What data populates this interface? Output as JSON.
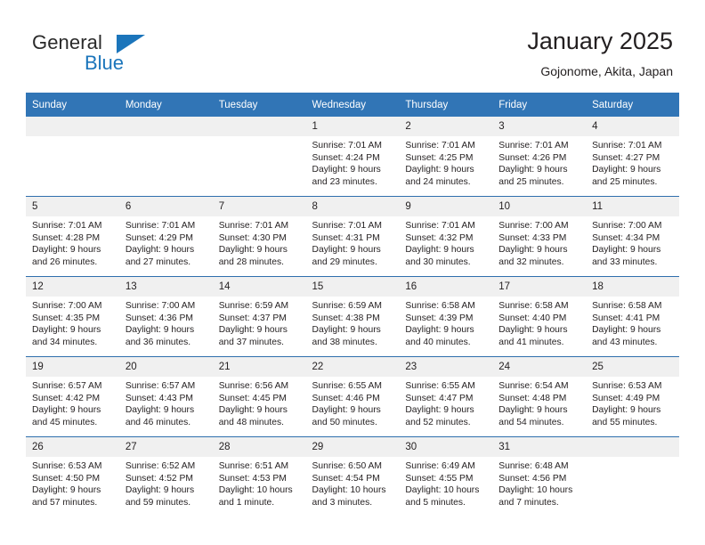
{
  "brand": {
    "name_part1": "General",
    "name_part2": "Blue",
    "triangle_icon": "brand-triangle-icon",
    "accent_color": "#1b75bb"
  },
  "header": {
    "title": "January 2025",
    "subtitle": "Gojonome, Akita, Japan",
    "header_bg_color": "#3175b6",
    "daynum_bg_color": "#f0f0f0"
  },
  "weekday_headers": [
    "Sunday",
    "Monday",
    "Tuesday",
    "Wednesday",
    "Thursday",
    "Friday",
    "Saturday"
  ],
  "weeks": [
    [
      {
        "empty": true,
        "day": "",
        "sunrise": "",
        "sunset": "",
        "daylight_line1": "",
        "daylight_line2": ""
      },
      {
        "empty": true,
        "day": "",
        "sunrise": "",
        "sunset": "",
        "daylight_line1": "",
        "daylight_line2": ""
      },
      {
        "empty": true,
        "day": "",
        "sunrise": "",
        "sunset": "",
        "daylight_line1": "",
        "daylight_line2": ""
      },
      {
        "empty": false,
        "day": "1",
        "sunrise": "Sunrise: 7:01 AM",
        "sunset": "Sunset: 4:24 PM",
        "daylight_line1": "Daylight: 9 hours",
        "daylight_line2": "and 23 minutes."
      },
      {
        "empty": false,
        "day": "2",
        "sunrise": "Sunrise: 7:01 AM",
        "sunset": "Sunset: 4:25 PM",
        "daylight_line1": "Daylight: 9 hours",
        "daylight_line2": "and 24 minutes."
      },
      {
        "empty": false,
        "day": "3",
        "sunrise": "Sunrise: 7:01 AM",
        "sunset": "Sunset: 4:26 PM",
        "daylight_line1": "Daylight: 9 hours",
        "daylight_line2": "and 25 minutes."
      },
      {
        "empty": false,
        "day": "4",
        "sunrise": "Sunrise: 7:01 AM",
        "sunset": "Sunset: 4:27 PM",
        "daylight_line1": "Daylight: 9 hours",
        "daylight_line2": "and 25 minutes."
      }
    ],
    [
      {
        "empty": false,
        "day": "5",
        "sunrise": "Sunrise: 7:01 AM",
        "sunset": "Sunset: 4:28 PM",
        "daylight_line1": "Daylight: 9 hours",
        "daylight_line2": "and 26 minutes."
      },
      {
        "empty": false,
        "day": "6",
        "sunrise": "Sunrise: 7:01 AM",
        "sunset": "Sunset: 4:29 PM",
        "daylight_line1": "Daylight: 9 hours",
        "daylight_line2": "and 27 minutes."
      },
      {
        "empty": false,
        "day": "7",
        "sunrise": "Sunrise: 7:01 AM",
        "sunset": "Sunset: 4:30 PM",
        "daylight_line1": "Daylight: 9 hours",
        "daylight_line2": "and 28 minutes."
      },
      {
        "empty": false,
        "day": "8",
        "sunrise": "Sunrise: 7:01 AM",
        "sunset": "Sunset: 4:31 PM",
        "daylight_line1": "Daylight: 9 hours",
        "daylight_line2": "and 29 minutes."
      },
      {
        "empty": false,
        "day": "9",
        "sunrise": "Sunrise: 7:01 AM",
        "sunset": "Sunset: 4:32 PM",
        "daylight_line1": "Daylight: 9 hours",
        "daylight_line2": "and 30 minutes."
      },
      {
        "empty": false,
        "day": "10",
        "sunrise": "Sunrise: 7:00 AM",
        "sunset": "Sunset: 4:33 PM",
        "daylight_line1": "Daylight: 9 hours",
        "daylight_line2": "and 32 minutes."
      },
      {
        "empty": false,
        "day": "11",
        "sunrise": "Sunrise: 7:00 AM",
        "sunset": "Sunset: 4:34 PM",
        "daylight_line1": "Daylight: 9 hours",
        "daylight_line2": "and 33 minutes."
      }
    ],
    [
      {
        "empty": false,
        "day": "12",
        "sunrise": "Sunrise: 7:00 AM",
        "sunset": "Sunset: 4:35 PM",
        "daylight_line1": "Daylight: 9 hours",
        "daylight_line2": "and 34 minutes."
      },
      {
        "empty": false,
        "day": "13",
        "sunrise": "Sunrise: 7:00 AM",
        "sunset": "Sunset: 4:36 PM",
        "daylight_line1": "Daylight: 9 hours",
        "daylight_line2": "and 36 minutes."
      },
      {
        "empty": false,
        "day": "14",
        "sunrise": "Sunrise: 6:59 AM",
        "sunset": "Sunset: 4:37 PM",
        "daylight_line1": "Daylight: 9 hours",
        "daylight_line2": "and 37 minutes."
      },
      {
        "empty": false,
        "day": "15",
        "sunrise": "Sunrise: 6:59 AM",
        "sunset": "Sunset: 4:38 PM",
        "daylight_line1": "Daylight: 9 hours",
        "daylight_line2": "and 38 minutes."
      },
      {
        "empty": false,
        "day": "16",
        "sunrise": "Sunrise: 6:58 AM",
        "sunset": "Sunset: 4:39 PM",
        "daylight_line1": "Daylight: 9 hours",
        "daylight_line2": "and 40 minutes."
      },
      {
        "empty": false,
        "day": "17",
        "sunrise": "Sunrise: 6:58 AM",
        "sunset": "Sunset: 4:40 PM",
        "daylight_line1": "Daylight: 9 hours",
        "daylight_line2": "and 41 minutes."
      },
      {
        "empty": false,
        "day": "18",
        "sunrise": "Sunrise: 6:58 AM",
        "sunset": "Sunset: 4:41 PM",
        "daylight_line1": "Daylight: 9 hours",
        "daylight_line2": "and 43 minutes."
      }
    ],
    [
      {
        "empty": false,
        "day": "19",
        "sunrise": "Sunrise: 6:57 AM",
        "sunset": "Sunset: 4:42 PM",
        "daylight_line1": "Daylight: 9 hours",
        "daylight_line2": "and 45 minutes."
      },
      {
        "empty": false,
        "day": "20",
        "sunrise": "Sunrise: 6:57 AM",
        "sunset": "Sunset: 4:43 PM",
        "daylight_line1": "Daylight: 9 hours",
        "daylight_line2": "and 46 minutes."
      },
      {
        "empty": false,
        "day": "21",
        "sunrise": "Sunrise: 6:56 AM",
        "sunset": "Sunset: 4:45 PM",
        "daylight_line1": "Daylight: 9 hours",
        "daylight_line2": "and 48 minutes."
      },
      {
        "empty": false,
        "day": "22",
        "sunrise": "Sunrise: 6:55 AM",
        "sunset": "Sunset: 4:46 PM",
        "daylight_line1": "Daylight: 9 hours",
        "daylight_line2": "and 50 minutes."
      },
      {
        "empty": false,
        "day": "23",
        "sunrise": "Sunrise: 6:55 AM",
        "sunset": "Sunset: 4:47 PM",
        "daylight_line1": "Daylight: 9 hours",
        "daylight_line2": "and 52 minutes."
      },
      {
        "empty": false,
        "day": "24",
        "sunrise": "Sunrise: 6:54 AM",
        "sunset": "Sunset: 4:48 PM",
        "daylight_line1": "Daylight: 9 hours",
        "daylight_line2": "and 54 minutes."
      },
      {
        "empty": false,
        "day": "25",
        "sunrise": "Sunrise: 6:53 AM",
        "sunset": "Sunset: 4:49 PM",
        "daylight_line1": "Daylight: 9 hours",
        "daylight_line2": "and 55 minutes."
      }
    ],
    [
      {
        "empty": false,
        "day": "26",
        "sunrise": "Sunrise: 6:53 AM",
        "sunset": "Sunset: 4:50 PM",
        "daylight_line1": "Daylight: 9 hours",
        "daylight_line2": "and 57 minutes."
      },
      {
        "empty": false,
        "day": "27",
        "sunrise": "Sunrise: 6:52 AM",
        "sunset": "Sunset: 4:52 PM",
        "daylight_line1": "Daylight: 9 hours",
        "daylight_line2": "and 59 minutes."
      },
      {
        "empty": false,
        "day": "28",
        "sunrise": "Sunrise: 6:51 AM",
        "sunset": "Sunset: 4:53 PM",
        "daylight_line1": "Daylight: 10 hours",
        "daylight_line2": "and 1 minute."
      },
      {
        "empty": false,
        "day": "29",
        "sunrise": "Sunrise: 6:50 AM",
        "sunset": "Sunset: 4:54 PM",
        "daylight_line1": "Daylight: 10 hours",
        "daylight_line2": "and 3 minutes."
      },
      {
        "empty": false,
        "day": "30",
        "sunrise": "Sunrise: 6:49 AM",
        "sunset": "Sunset: 4:55 PM",
        "daylight_line1": "Daylight: 10 hours",
        "daylight_line2": "and 5 minutes."
      },
      {
        "empty": false,
        "day": "31",
        "sunrise": "Sunrise: 6:48 AM",
        "sunset": "Sunset: 4:56 PM",
        "daylight_line1": "Daylight: 10 hours",
        "daylight_line2": "and 7 minutes."
      },
      {
        "empty": true,
        "day": "",
        "sunrise": "",
        "sunset": "",
        "daylight_line1": "",
        "daylight_line2": ""
      }
    ]
  ]
}
